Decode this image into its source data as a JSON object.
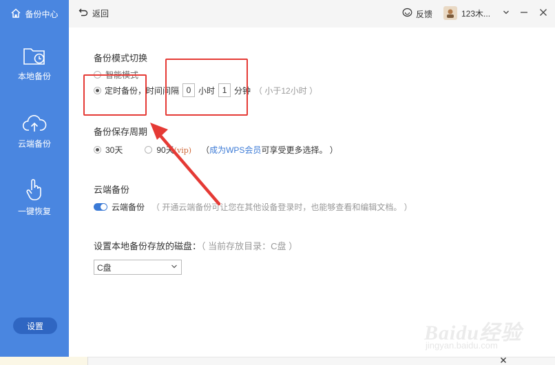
{
  "sidebar": {
    "brand": {
      "label": "备份中心",
      "icon": "home-icon"
    },
    "items": [
      {
        "label": "本地备份",
        "icon": "folder-clock-icon"
      },
      {
        "label": "云端备份",
        "icon": "cloud-upload-icon"
      },
      {
        "label": "一键恢复",
        "icon": "hand-pointer-icon"
      }
    ],
    "settings_label": "设置",
    "color": "#4a86e0"
  },
  "topbar": {
    "back_label": "返回",
    "feedback_label": "反馈",
    "user_name": "123木..."
  },
  "backup_mode": {
    "title": "备份模式切换",
    "smart_label": "智能模式",
    "timed_label": "定时备份，时间间隔",
    "timed_selected": true,
    "hours_value": "0",
    "hours_unit": "小时",
    "minutes_value": "1",
    "minutes_unit": "分钟",
    "hint": "（ 小于12小时 ）"
  },
  "retention": {
    "title": "备份保存周期",
    "option_30": "30天",
    "option_90": "90天",
    "vip_tag": "(vip)",
    "note_prefix": "（",
    "member_link": "成为WPS会员",
    "note_suffix": "可享受更多选择。 ）",
    "selected": "30天"
  },
  "cloud": {
    "title": "云端备份",
    "toggle_label": "云端备份",
    "toggle_on": true,
    "description": "（ 开通云端备份可让您在其他设备登录时，也能够查看和编辑文档。 ）"
  },
  "disk": {
    "title": "设置本地备份存放的磁盘：",
    "current_hint": "（ 当前存放目录：C盘 ）",
    "selected": "C盘"
  },
  "watermark": {
    "main": "Baidu经验",
    "sub": "jingyan.baidu.com"
  },
  "colors": {
    "accent": "#4a86e0",
    "annotation": "#e53a35",
    "link": "#3b7ad6"
  }
}
